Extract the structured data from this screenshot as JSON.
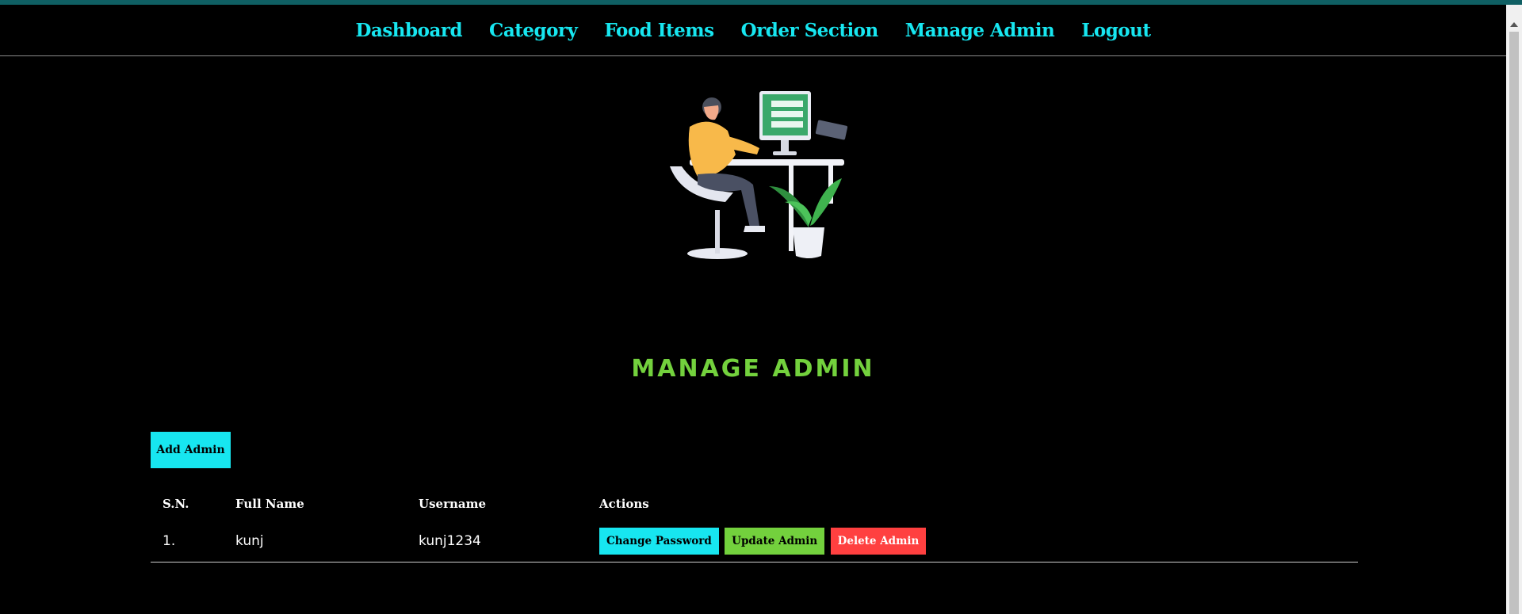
{
  "nav": {
    "items": [
      "Dashboard",
      "Category",
      "Food Items",
      "Order Section",
      "Manage Admin",
      "Logout"
    ]
  },
  "hero": {
    "alt": "person working at a desktop computer with a plant"
  },
  "page": {
    "title": "MANAGE ADMIN",
    "add_button": "Add Admin"
  },
  "table": {
    "headers": [
      "S.N.",
      "Full Name",
      "Username",
      "Actions"
    ],
    "rows": [
      {
        "sn": "1.",
        "full_name": "kunj",
        "username": "kunj1234"
      }
    ],
    "actions": {
      "change_password": "Change Password",
      "update": "Update Admin",
      "delete": "Delete Admin"
    }
  },
  "colors": {
    "accent_cyan": "#17e6f0",
    "accent_green": "#73d13d",
    "danger": "#ff4040",
    "background": "#000000"
  }
}
